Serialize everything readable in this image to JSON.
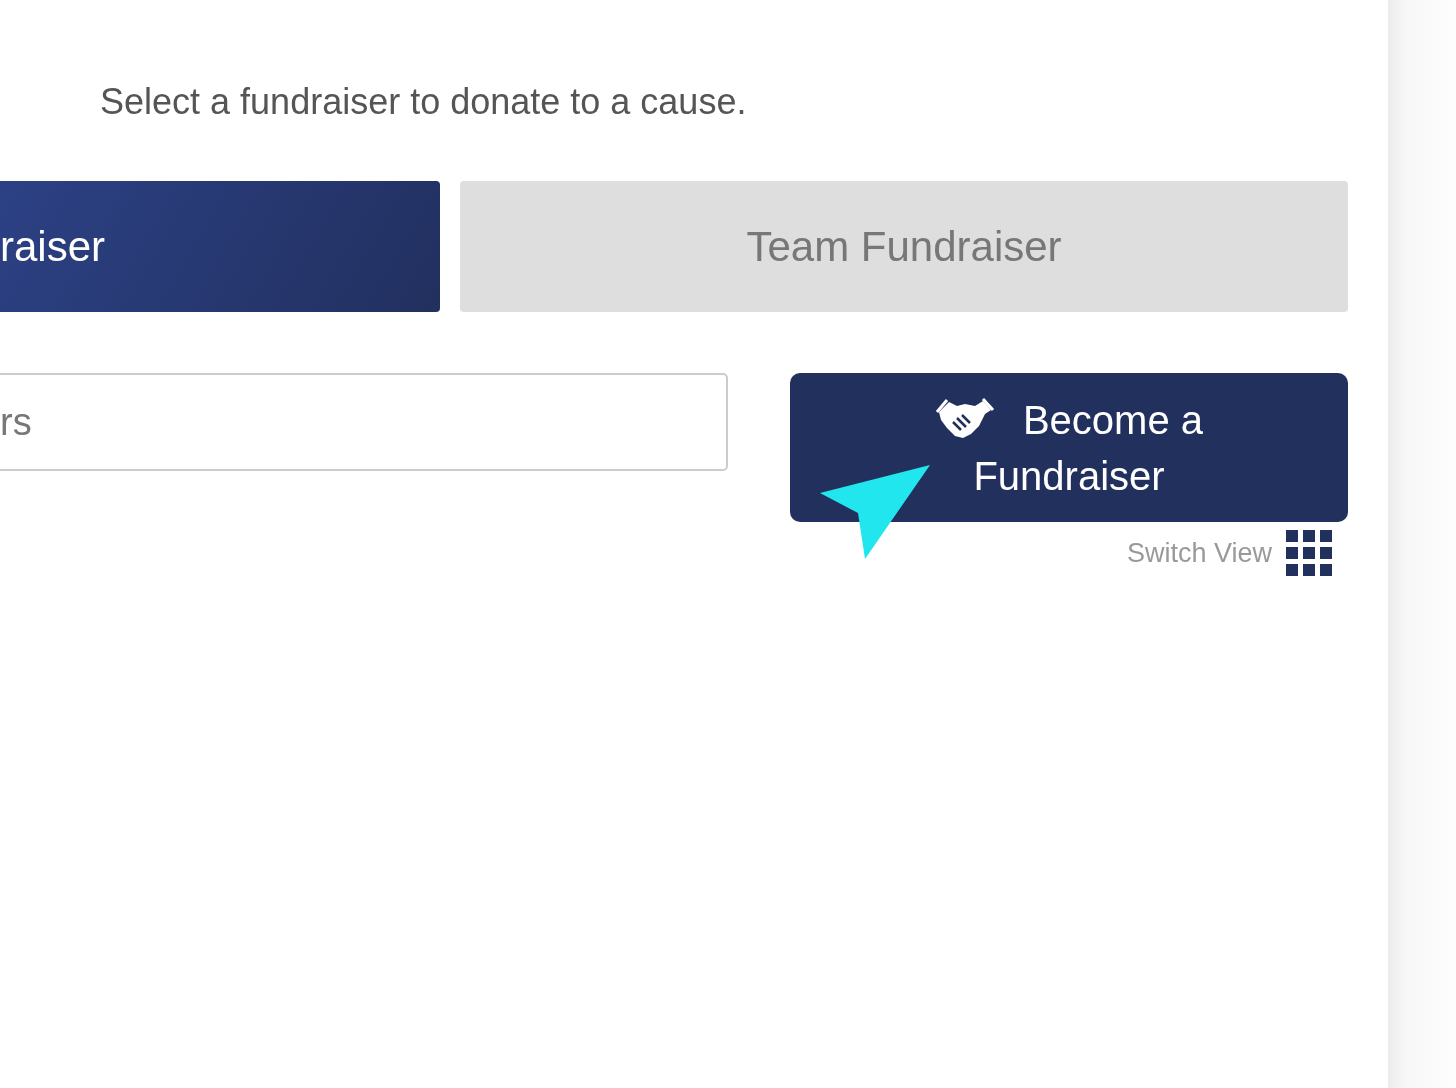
{
  "description": "Select a fundraiser to donate to a cause.",
  "tabs": [
    {
      "label": "raiser",
      "selected": true
    },
    {
      "label": "Team Fundraiser",
      "selected": false
    }
  ],
  "search": {
    "placeholder": "rs"
  },
  "become_button": {
    "label": "Become a Fundraiser"
  },
  "switch_view": {
    "label": "Switch View"
  }
}
